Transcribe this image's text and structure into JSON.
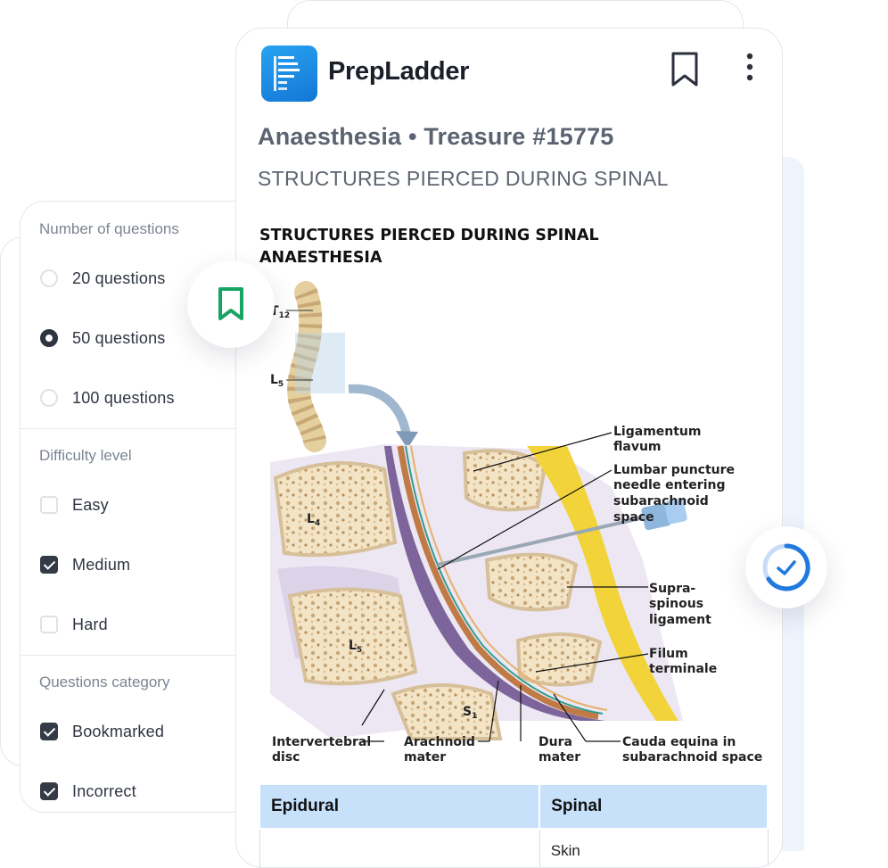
{
  "filters": {
    "number_title": "Number of questions",
    "number_options": [
      {
        "label": "20 questions",
        "selected": false
      },
      {
        "label": "50 questions",
        "selected": true
      },
      {
        "label": "100 questions",
        "selected": false
      }
    ],
    "difficulty_title": "Difficulty level",
    "difficulty_options": [
      {
        "label": "Easy",
        "checked": false
      },
      {
        "label": "Medium",
        "checked": true
      },
      {
        "label": "Hard",
        "checked": false
      }
    ],
    "category_title": "Questions category",
    "category_options": [
      {
        "label": "Bookmarked",
        "checked": true
      },
      {
        "label": "Incorrect",
        "checked": true
      }
    ]
  },
  "card": {
    "brand": "PrepLadder",
    "title": "Anaesthesia • Treasure #15775",
    "subtitle": "STRUCTURES PIERCED DURING SPINAL",
    "figure_title": "STRUCTURES PIERCED DURING SPINAL ANAESTHESIA",
    "figure_labels": {
      "t12": "T",
      "t12_sub": "12",
      "l5": "L",
      "l5_sub": "5",
      "l4_vert": "L",
      "l4_vert_sub": "4",
      "l5_vert": "L",
      "l5_vert_sub": "5",
      "s1": "S",
      "s1_sub": "1",
      "lig_flavum_1": "Ligamentum",
      "lig_flavum_2": "flavum",
      "lp_1": "Lumbar puncture",
      "lp_2": "needle entering",
      "lp_3": "subarachnoid",
      "lp_4": "space",
      "supra_1": "Supra-",
      "supra_2": "spinous",
      "supra_3": "ligament",
      "filum_1": "Filum",
      "filum_2": "terminale",
      "ivd_1": "Intervertebral",
      "ivd_2": "disc",
      "arach_1": "Arachnoid",
      "arach_2": "mater",
      "dura_1": "Dura",
      "dura_2": "mater",
      "cauda_1": "Cauda equina in",
      "cauda_2": "subarachnoid space"
    },
    "table": {
      "headers": [
        "Epidural",
        "Spinal"
      ],
      "row1": [
        "",
        "Skin"
      ]
    }
  },
  "colors": {
    "accent_green": "#17a463",
    "accent_blue": "#1f7ae0",
    "logo_blue": "#1b8ee6",
    "table_header": "#c7e1fb"
  },
  "icons": {
    "bookmark_bubble": "bookmark-icon",
    "card_bookmark": "bookmark-outline-icon",
    "more": "more-vertical-icon",
    "progress": "progress-check-icon"
  }
}
